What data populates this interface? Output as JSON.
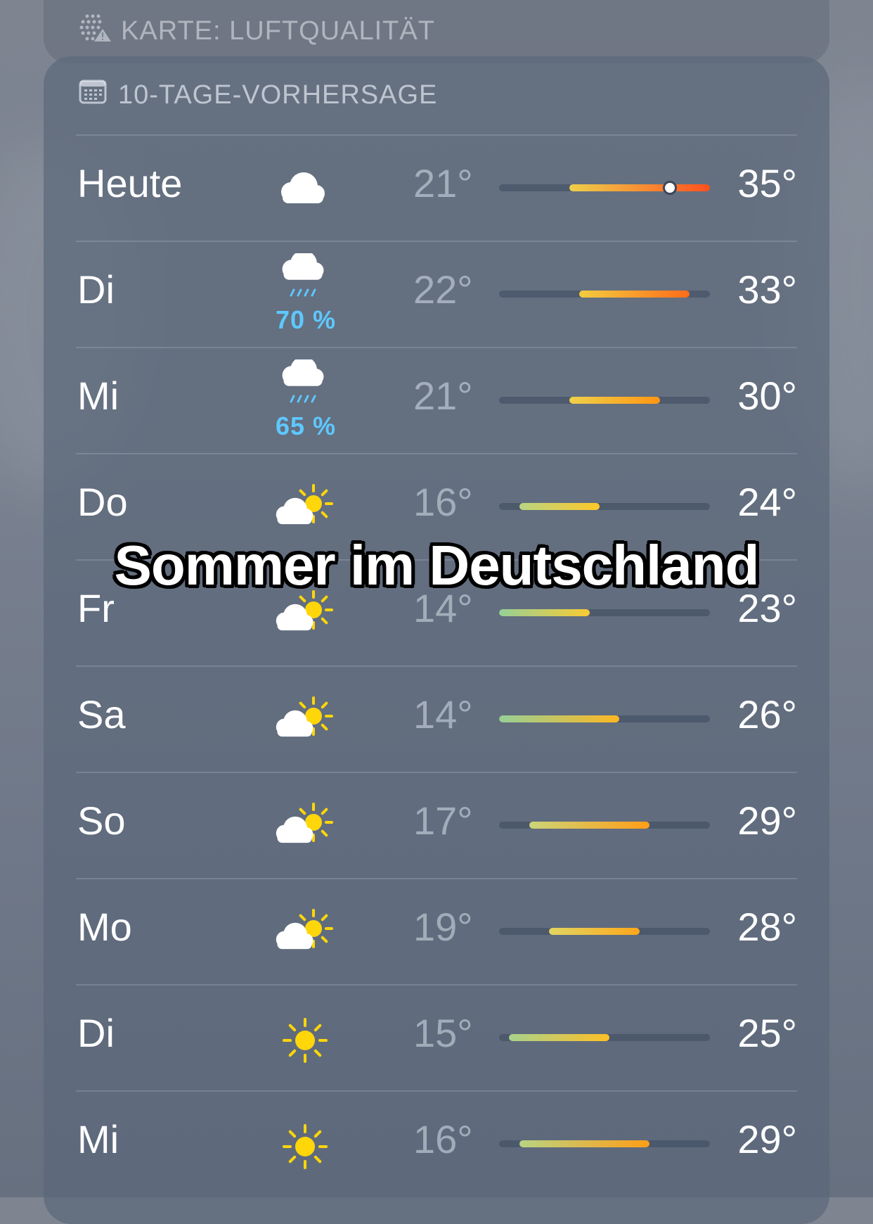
{
  "air_quality_card": {
    "title": "KARTE: LUFTQUALITÄT",
    "icon": "air-quality-icon"
  },
  "forecast": {
    "title": "10-TAGE-VORHERSAGE",
    "icon": "calendar-icon",
    "range_min": 14,
    "range_max": 35,
    "current_temp": 31,
    "days": [
      {
        "day": "Heute",
        "icon": "cloud",
        "precip": "",
        "low": "21°",
        "high": "35°",
        "low_val": 21,
        "high_val": 35,
        "current": true
      },
      {
        "day": "Di",
        "icon": "cloud-rain",
        "precip": "70 %",
        "low": "22°",
        "high": "33°",
        "low_val": 22,
        "high_val": 33
      },
      {
        "day": "Mi",
        "icon": "cloud-rain",
        "precip": "65 %",
        "low": "21°",
        "high": "30°",
        "low_val": 21,
        "high_val": 30
      },
      {
        "day": "Do",
        "icon": "partly-cloudy",
        "precip": "",
        "low": "16°",
        "high": "24°",
        "low_val": 16,
        "high_val": 24
      },
      {
        "day": "Fr",
        "icon": "partly-cloudy",
        "precip": "",
        "low": "14°",
        "high": "23°",
        "low_val": 14,
        "high_val": 23
      },
      {
        "day": "Sa",
        "icon": "partly-cloudy",
        "precip": "",
        "low": "14°",
        "high": "26°",
        "low_val": 14,
        "high_val": 26
      },
      {
        "day": "So",
        "icon": "partly-cloudy",
        "precip": "",
        "low": "17°",
        "high": "29°",
        "low_val": 17,
        "high_val": 29
      },
      {
        "day": "Mo",
        "icon": "partly-cloudy",
        "precip": "",
        "low": "19°",
        "high": "28°",
        "low_val": 19,
        "high_val": 28
      },
      {
        "day": "Di",
        "icon": "sun",
        "precip": "",
        "low": "15°",
        "high": "25°",
        "low_val": 15,
        "high_val": 25
      },
      {
        "day": "Mi",
        "icon": "sun",
        "precip": "",
        "low": "16°",
        "high": "29°",
        "low_val": 16,
        "high_val": 29
      }
    ]
  },
  "overlay_caption": "Sommer im Deutschland",
  "colors": {
    "precip_text": "#5ec8ff",
    "sun": "#ffd60a",
    "cloud": "#ffffff"
  }
}
